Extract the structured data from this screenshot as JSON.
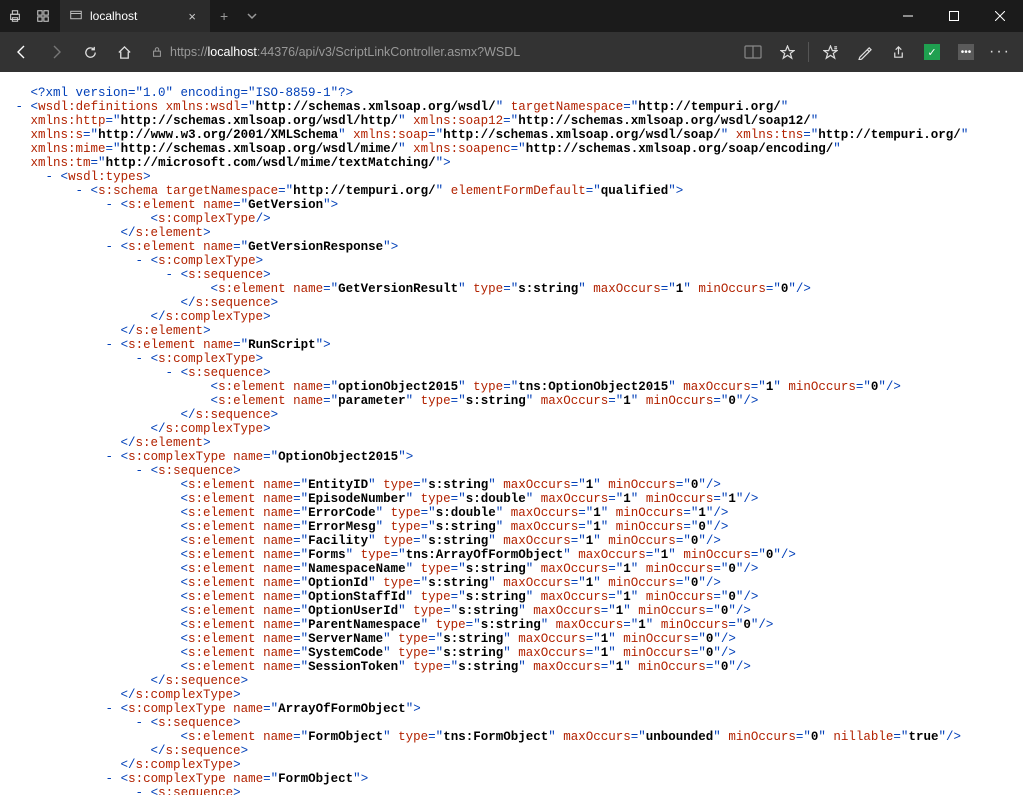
{
  "window": {
    "tab_title": "localhost"
  },
  "address": {
    "scheme": "https://",
    "host": "localhost",
    "path": ":44376/api/v3/ScriptLinkController.asmx?WSDL"
  },
  "xml": {
    "prolog": "<?xml version=\"1.0\" encoding=\"ISO-8859-1\"?>",
    "root": "wsdl:definitions",
    "root_attrs": [
      {
        "name": "xmlns:wsdl",
        "value": "http://schemas.xmlsoap.org/wsdl/"
      },
      {
        "name": "targetNamespace",
        "value": "http://tempuri.org/"
      },
      {
        "name": "xmlns:http",
        "value": "http://schemas.xmlsoap.org/wsdl/http/"
      },
      {
        "name": "xmlns:soap12",
        "value": "http://schemas.xmlsoap.org/wsdl/soap12/"
      },
      {
        "name": "xmlns:s",
        "value": "http://www.w3.org/2001/XMLSchema"
      },
      {
        "name": "xmlns:soap",
        "value": "http://schemas.xmlsoap.org/wsdl/soap/"
      },
      {
        "name": "xmlns:tns",
        "value": "http://tempuri.org/"
      },
      {
        "name": "xmlns:mime",
        "value": "http://schemas.xmlsoap.org/wsdl/mime/"
      },
      {
        "name": "xmlns:soapenc",
        "value": "http://schemas.xmlsoap.org/soap/encoding/"
      },
      {
        "name": "xmlns:tm",
        "value": "http://microsoft.com/wsdl/mime/textMatching/"
      }
    ],
    "wsdl_types": "wsdl:types",
    "schema": {
      "tag": "s:schema",
      "tns": "http://tempuri.org/",
      "efd": "qualified"
    },
    "e_getversion": "GetVersion",
    "complexType": "s:complexType",
    "element": "s:element",
    "sequence": "s:sequence",
    "e_getversionresponse": "GetVersionResponse",
    "getversionresult": {
      "name": "GetVersionResult",
      "type": "s:string",
      "max": "1",
      "min": "0"
    },
    "e_runscript": "RunScript",
    "runscript_fields": [
      {
        "name": "optionObject2015",
        "type": "tns:OptionObject2015",
        "max": "1",
        "min": "0"
      },
      {
        "name": "parameter",
        "type": "s:string",
        "max": "1",
        "min": "0"
      }
    ],
    "ct_optionobject": "OptionObject2015",
    "optionobject_fields": [
      {
        "name": "EntityID",
        "type": "s:string",
        "max": "1",
        "min": "0"
      },
      {
        "name": "EpisodeNumber",
        "type": "s:double",
        "max": "1",
        "min": "1"
      },
      {
        "name": "ErrorCode",
        "type": "s:double",
        "max": "1",
        "min": "1"
      },
      {
        "name": "ErrorMesg",
        "type": "s:string",
        "max": "1",
        "min": "0"
      },
      {
        "name": "Facility",
        "type": "s:string",
        "max": "1",
        "min": "0"
      },
      {
        "name": "Forms",
        "type": "tns:ArrayOfFormObject",
        "max": "1",
        "min": "0"
      },
      {
        "name": "NamespaceName",
        "type": "s:string",
        "max": "1",
        "min": "0"
      },
      {
        "name": "OptionId",
        "type": "s:string",
        "max": "1",
        "min": "0"
      },
      {
        "name": "OptionStaffId",
        "type": "s:string",
        "max": "1",
        "min": "0"
      },
      {
        "name": "OptionUserId",
        "type": "s:string",
        "max": "1",
        "min": "0"
      },
      {
        "name": "ParentNamespace",
        "type": "s:string",
        "max": "1",
        "min": "0"
      },
      {
        "name": "ServerName",
        "type": "s:string",
        "max": "1",
        "min": "0"
      },
      {
        "name": "SystemCode",
        "type": "s:string",
        "max": "1",
        "min": "0"
      },
      {
        "name": "SessionToken",
        "type": "s:string",
        "max": "1",
        "min": "0"
      }
    ],
    "ct_arrayofformobject": "ArrayOfFormObject",
    "formobject_el": {
      "name": "FormObject",
      "type": "tns:FormObject",
      "max": "unbounded",
      "min": "0",
      "nillable": "true"
    },
    "ct_formobject": "FormObject"
  }
}
